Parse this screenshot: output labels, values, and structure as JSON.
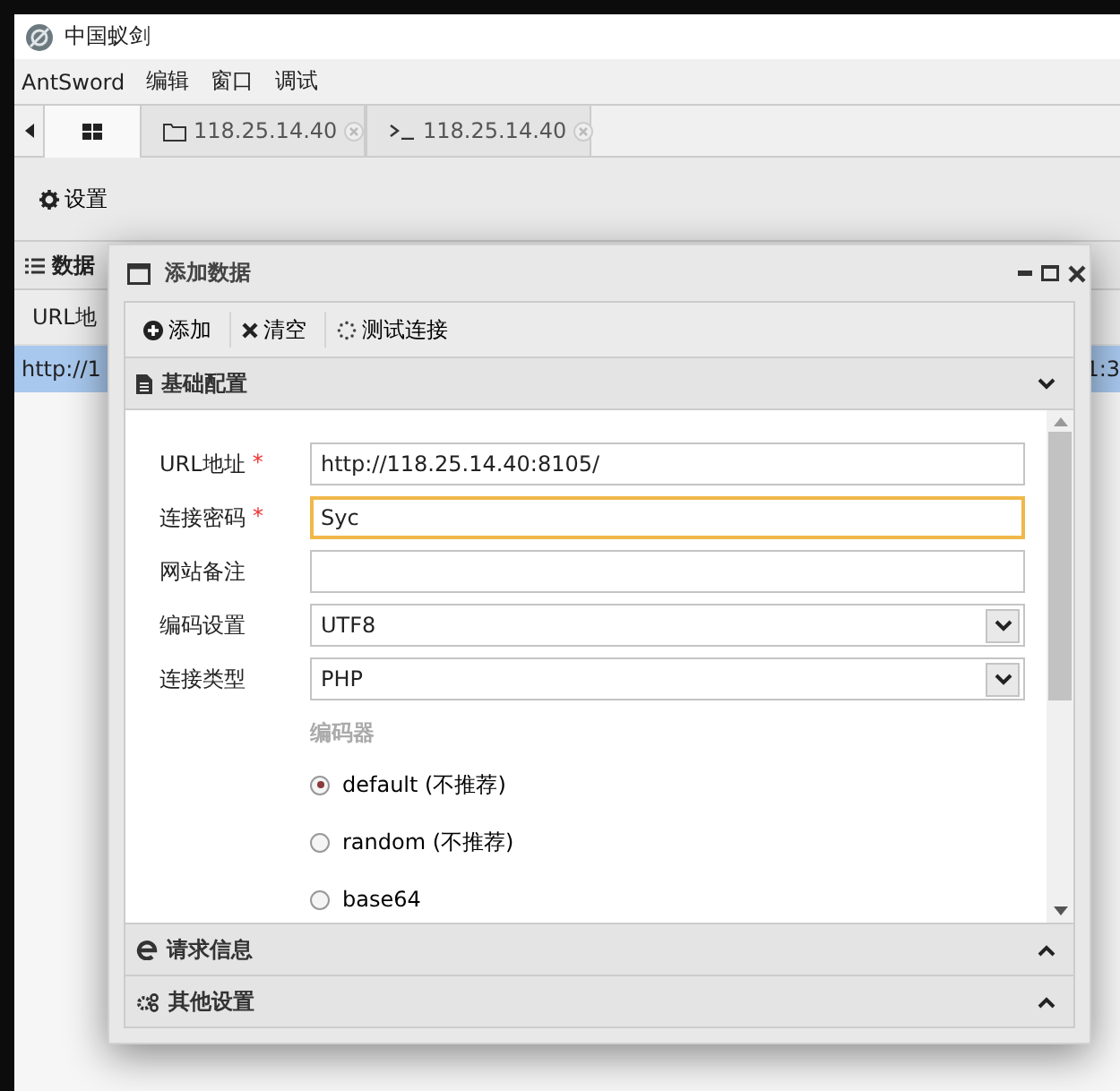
{
  "window": {
    "title": "中国蚁剑"
  },
  "menu": [
    "AntSword",
    "编辑",
    "窗口",
    "调试"
  ],
  "tabs": [
    {
      "kind": "home",
      "selected": true
    },
    {
      "kind": "folder",
      "label": "118.25.14.40",
      "selected": false
    },
    {
      "kind": "terminal",
      "label": "118.25.14.40",
      "selected": false
    }
  ],
  "toolbar": {
    "settings": "设置"
  },
  "background_panel": {
    "title": "数据",
    "column_1": "URL地",
    "row_1": {
      "cell_1": "http://1",
      "cell_2": "1:3",
      "selected": true
    }
  },
  "dialog": {
    "title": "添加数据",
    "buttons": [
      {
        "kind": "add",
        "label": "添加"
      },
      {
        "kind": "clear",
        "label": "清空"
      },
      {
        "kind": "test",
        "label": "测试连接"
      }
    ],
    "sections": [
      {
        "kind": "basic",
        "title": "基础配置",
        "expanded": true
      },
      {
        "kind": "request",
        "title": "请求信息",
        "expanded": false
      },
      {
        "kind": "other",
        "title": "其他设置",
        "expanded": false
      }
    ],
    "fields": [
      {
        "kind": "text",
        "label": "URL地址",
        "required_mark": "*",
        "value": "http://118.25.14.40:8105/",
        "focused": false
      },
      {
        "kind": "text",
        "label": "连接密码",
        "required_mark": "*",
        "value": "Syc",
        "focused": true
      },
      {
        "kind": "text",
        "label": "网站备注",
        "focused": false
      },
      {
        "kind": "select",
        "label": "编码设置",
        "value": "UTF8"
      },
      {
        "kind": "select",
        "label": "连接类型",
        "value": "PHP"
      }
    ],
    "encoder": {
      "title": "编码器",
      "options": [
        {
          "label": "default (不推荐)",
          "selected": true
        },
        {
          "label": "random (不推荐)",
          "selected": false
        },
        {
          "label": "base64",
          "selected": false
        }
      ]
    }
  }
}
